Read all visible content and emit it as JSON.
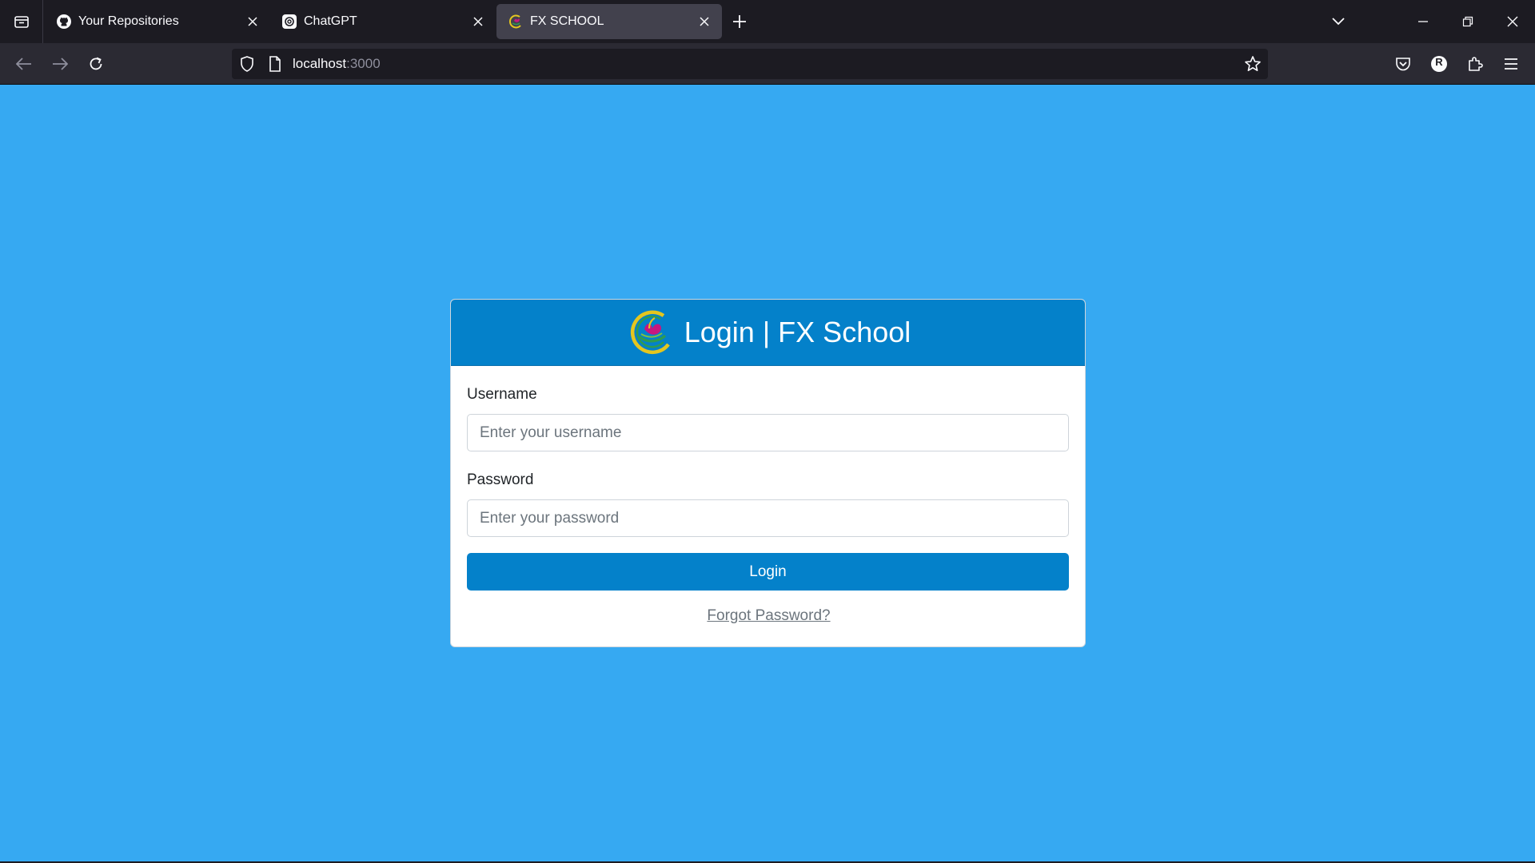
{
  "browser": {
    "tabs": [
      {
        "title": "Your Repositories",
        "favicon": "github-icon",
        "active": false
      },
      {
        "title": "ChatGPT",
        "favicon": "chatgpt-icon",
        "active": false
      },
      {
        "title": "FX SCHOOL",
        "favicon": "fx-school-icon",
        "active": true
      }
    ],
    "url": {
      "host": "localhost",
      "port": ":3000"
    },
    "profile_initial": "R"
  },
  "login": {
    "header_title": "Login | FX School",
    "username_label": "Username",
    "username_placeholder": "Enter your username",
    "password_label": "Password",
    "password_placeholder": "Enter your password",
    "login_button": "Login",
    "forgot_link": "Forgot Password?"
  },
  "colors": {
    "page_background": "#36a9f2",
    "primary": "#0481ca",
    "card_background": "#ffffff"
  }
}
